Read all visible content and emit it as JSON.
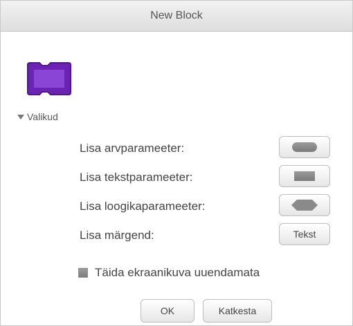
{
  "dialog": {
    "title": "New Block"
  },
  "preview": {
    "block_color": "#7a2fbf",
    "block_icon": "custom-block-shape-icon"
  },
  "options": {
    "section_label": "Valikud",
    "number_param_label": "Lisa arvparameeter:",
    "text_param_label": "Lisa tekstparameeter:",
    "boolean_param_label": "Lisa loogikaparameeter:",
    "label_text_label": "Lisa märgend:",
    "label_button_text": "Tekst",
    "run_without_refresh_label": "Täida ekraanikuva uuendamata"
  },
  "buttons": {
    "ok": "OK",
    "cancel": "Katkesta"
  }
}
